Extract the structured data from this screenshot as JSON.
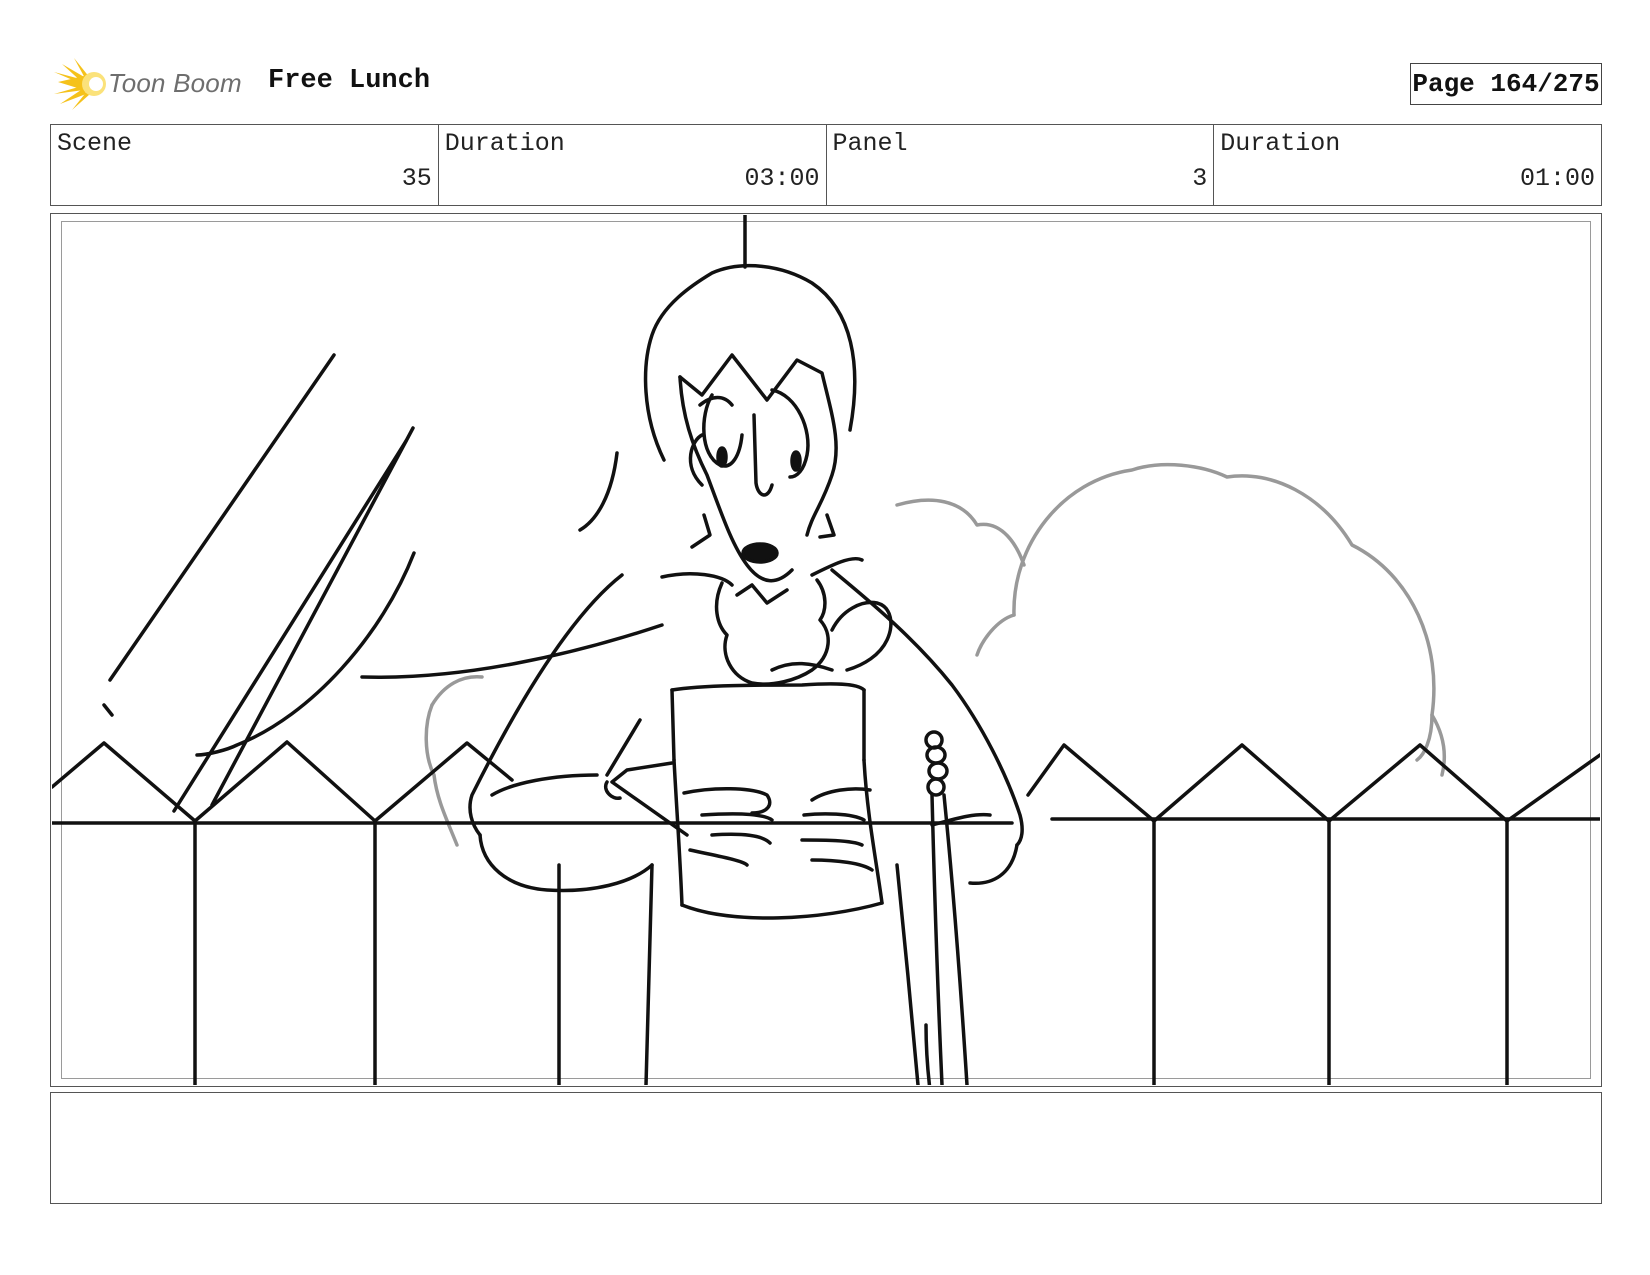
{
  "header": {
    "logo_text": "Toon Boom",
    "project_title": "Free Lunch",
    "page_label": "Page 164/275"
  },
  "info": {
    "scene_label": "Scene",
    "scene_value": "35",
    "scene_duration_label": "Duration",
    "scene_duration_value": "03:00",
    "panel_label": "Panel",
    "panel_value": "3",
    "panel_duration_label": "Duration",
    "panel_duration_value": "01:00"
  },
  "notes": {
    "text": ""
  },
  "colors": {
    "logo_flare": "#f5c21b",
    "logo_flare_core": "#fbe27a",
    "line_dark": "#111111",
    "line_bush": "#999999",
    "frame": "#555555"
  },
  "icons": {
    "logo": "toon-boom-flare-icon"
  }
}
